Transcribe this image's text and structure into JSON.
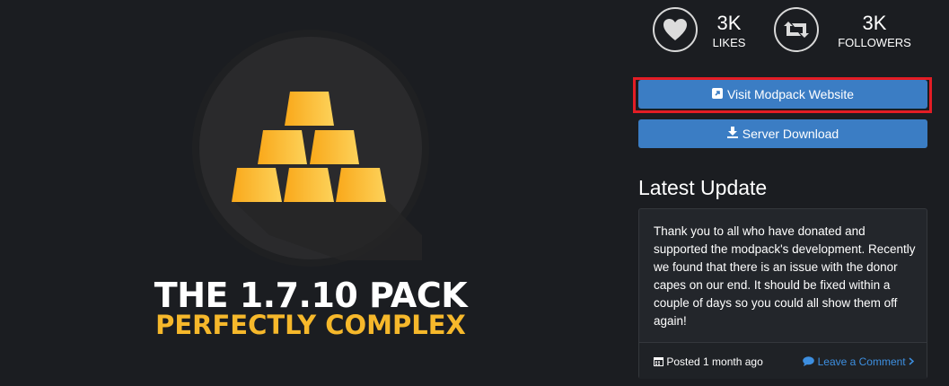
{
  "logo": {
    "title_line1": "THE 1.7.10 PACK",
    "title_line2": "PERFECTLY COMPLEX",
    "colors": {
      "gold": "#f6b82b",
      "circle": "#2a2a2c"
    }
  },
  "stats": {
    "likes": {
      "count": "3K",
      "label": "LIKES",
      "icon": "heart-icon"
    },
    "followers": {
      "count": "3K",
      "label": "FOLLOWERS",
      "icon": "retweet-icon"
    }
  },
  "buttons": {
    "visit_website": {
      "label": "Visit Modpack Website",
      "icon": "external-link-icon"
    },
    "server_download": {
      "label": "Server Download",
      "icon": "download-icon"
    }
  },
  "latest_update": {
    "heading": "Latest Update",
    "body": "Thank you to all who have donated and supported the modpack's development. Recently we found that there is an issue with the donor capes on our end. It should be fixed within a couple of days so you could all show them off again!",
    "posted": "Posted 1 month ago",
    "comment_link": "Leave a Comment",
    "icons": {
      "posted": "calendar-icon",
      "comment": "comment-icon",
      "chevron": "chevron-right-icon"
    }
  },
  "colors": {
    "accent": "#3b7dc4",
    "highlight": "#e31d25",
    "link": "#3d8fe0",
    "background": "#1b1d21"
  }
}
